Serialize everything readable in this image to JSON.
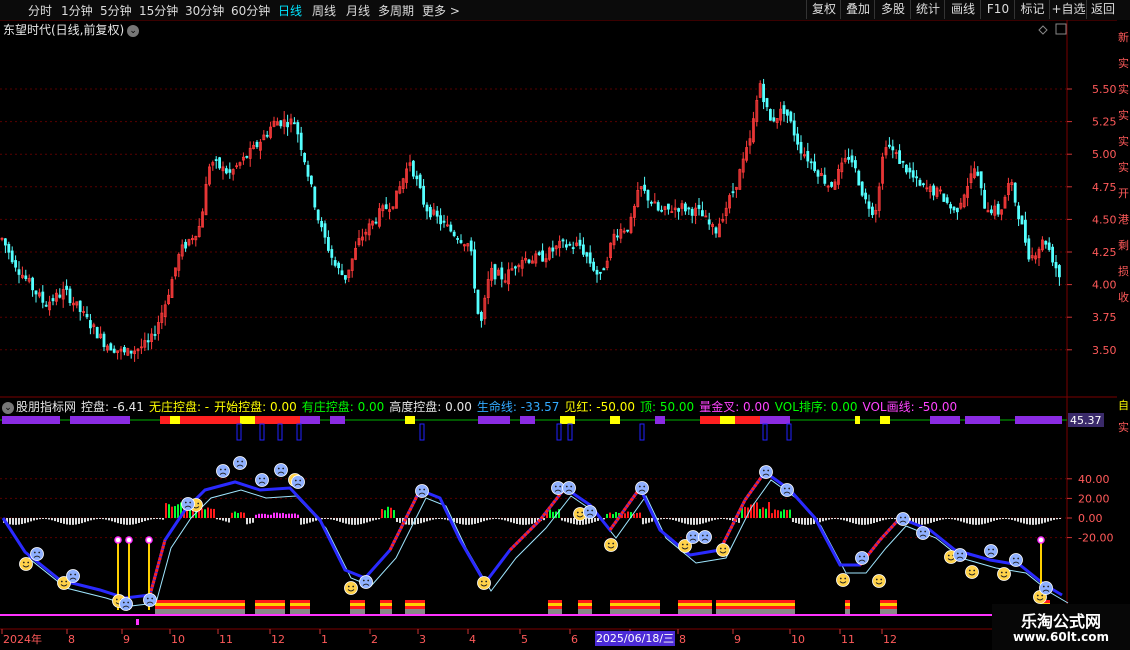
{
  "toolbar": {
    "periods": [
      "分时",
      "1分钟",
      "5分钟",
      "15分钟",
      "30分钟",
      "60分钟",
      "日线",
      "周线",
      "月线",
      "多周期",
      "更多 >"
    ],
    "active_period": "日线",
    "buttons": [
      "复权",
      "叠加",
      "多股",
      "统计",
      "画线",
      "F10",
      "标记",
      "+自选",
      "返回"
    ]
  },
  "main_chart": {
    "title": "东望时代(日线,前复权)",
    "y_ticks": [
      "5.50",
      "5.25",
      "5.00",
      "4.75",
      "4.50",
      "4.25",
      "4.00",
      "3.75",
      "3.50"
    ],
    "y_values": [
      5.5,
      5.25,
      5.0,
      4.75,
      4.5,
      4.25,
      4.0,
      3.75,
      3.5
    ]
  },
  "indicator": {
    "name": "股朋指标网",
    "fields": [
      {
        "label": "控盘: -6.41",
        "color": "#e6e6e6"
      },
      {
        "label": "无庄控盘: -",
        "color": "#ffff00"
      },
      {
        "label": "开始控盘: 0.00",
        "color": "#ffff00"
      },
      {
        "label": "有庄控盘: 0.00",
        "color": "#00ff00"
      },
      {
        "label": "高度控盘: 0.00",
        "color": "#e6e6e6"
      },
      {
        "label": "生命线: -33.57",
        "color": "#33aaff"
      },
      {
        "label": "见红: -50.00",
        "color": "#ffff00"
      },
      {
        "label": "顶: 50.00",
        "color": "#00ff00"
      },
      {
        "label": "量金叉: 0.00",
        "color": "#ff44ff"
      },
      {
        "label": "VOL排序: 0.00",
        "color": "#00ff00"
      },
      {
        "label": "VOL画线: -50.00",
        "color": "#ff44ff"
      }
    ],
    "value_box": "45.37",
    "y_ticks": [
      "40.00",
      "20.00",
      "0.00",
      "-20.00"
    ],
    "y_values": [
      40,
      20,
      0,
      -20
    ]
  },
  "x_axis": {
    "labels": [
      "2024年",
      "8",
      "9",
      "10",
      "11",
      "12",
      "1",
      "2",
      "3",
      "4",
      "5",
      "6",
      "7",
      "8",
      "9",
      "10",
      "11",
      "12"
    ],
    "cursor_date": "2025/06/18/三"
  },
  "right_strip": [
    "新",
    "实",
    "实",
    "实",
    "实",
    "实",
    "开",
    "港",
    "剩",
    "损",
    "收"
  ],
  "right_strip2": [
    "自",
    "实"
  ],
  "watermark": {
    "line1": "乐淘公式网",
    "line2": "www.60lt.com"
  },
  "colors": {
    "up": "#ff3b3b",
    "down": "#54ffff",
    "grid": "#5a0000",
    "life": "#33aaff",
    "blue": "#2222ff",
    "yellow": "#ffd24a",
    "purple": "#8a2be2"
  }
}
